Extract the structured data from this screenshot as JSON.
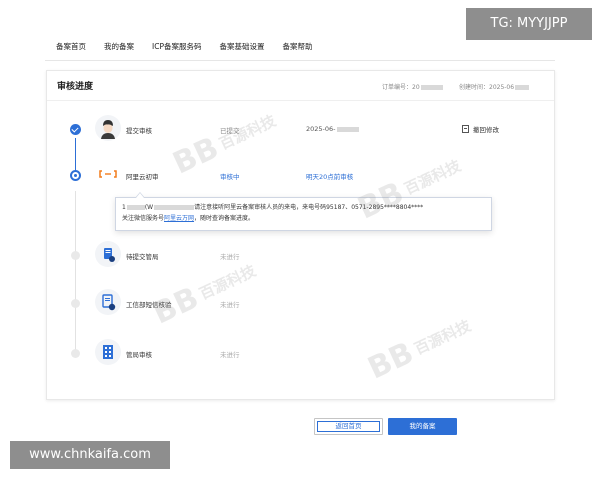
{
  "watermarks": {
    "top_right": "TG: MYYJJPP",
    "bottom_left": "www.chnkaifa.com",
    "brand_mark": "BB",
    "brand_text": "百源科技"
  },
  "nav": {
    "items": [
      {
        "label": "备案首页"
      },
      {
        "label": "我的备案"
      },
      {
        "label": "ICP备案服务码"
      },
      {
        "label": "备案基础设置"
      },
      {
        "label": "备案帮助"
      }
    ]
  },
  "card": {
    "title": "审核进度",
    "order_label": "订单编号：20",
    "created_label": "创建时间：2025-06",
    "undo_label": "撤回修改"
  },
  "steps": [
    {
      "name": "提交审核",
      "status": "已提交",
      "time": "2025-06-",
      "icon": "person-avatar-icon"
    },
    {
      "name": "阿里云初审",
      "status": "审核中",
      "time": "明天20点前审核",
      "icon": "aliyun-logo-icon"
    },
    {
      "name": "待提交管局",
      "status": "未进行",
      "time": "",
      "icon": "document-submit-icon"
    },
    {
      "name": "工信部短信核验",
      "status": "未进行",
      "time": "",
      "icon": "phone-sms-icon"
    },
    {
      "name": "管局审核",
      "status": "未进行",
      "time": "",
      "icon": "building-icon"
    }
  ],
  "popup": {
    "line1_prefix": "1",
    "line1_mid": "(W",
    "line1_text": "请注意接听阿里云备案审核人员的来电，来电号码95187、0571-2895****8804****",
    "line2_prefix": "关注微信服务号",
    "line2_link": "阿里云万网",
    "line2_suffix": "，随时查询备案进度。"
  },
  "buttons": {
    "back": "返回首页",
    "mine": "我的备案"
  },
  "colors": {
    "primary": "#2d6fd6",
    "pending": "#e9e9e9",
    "muted": "#888888"
  }
}
